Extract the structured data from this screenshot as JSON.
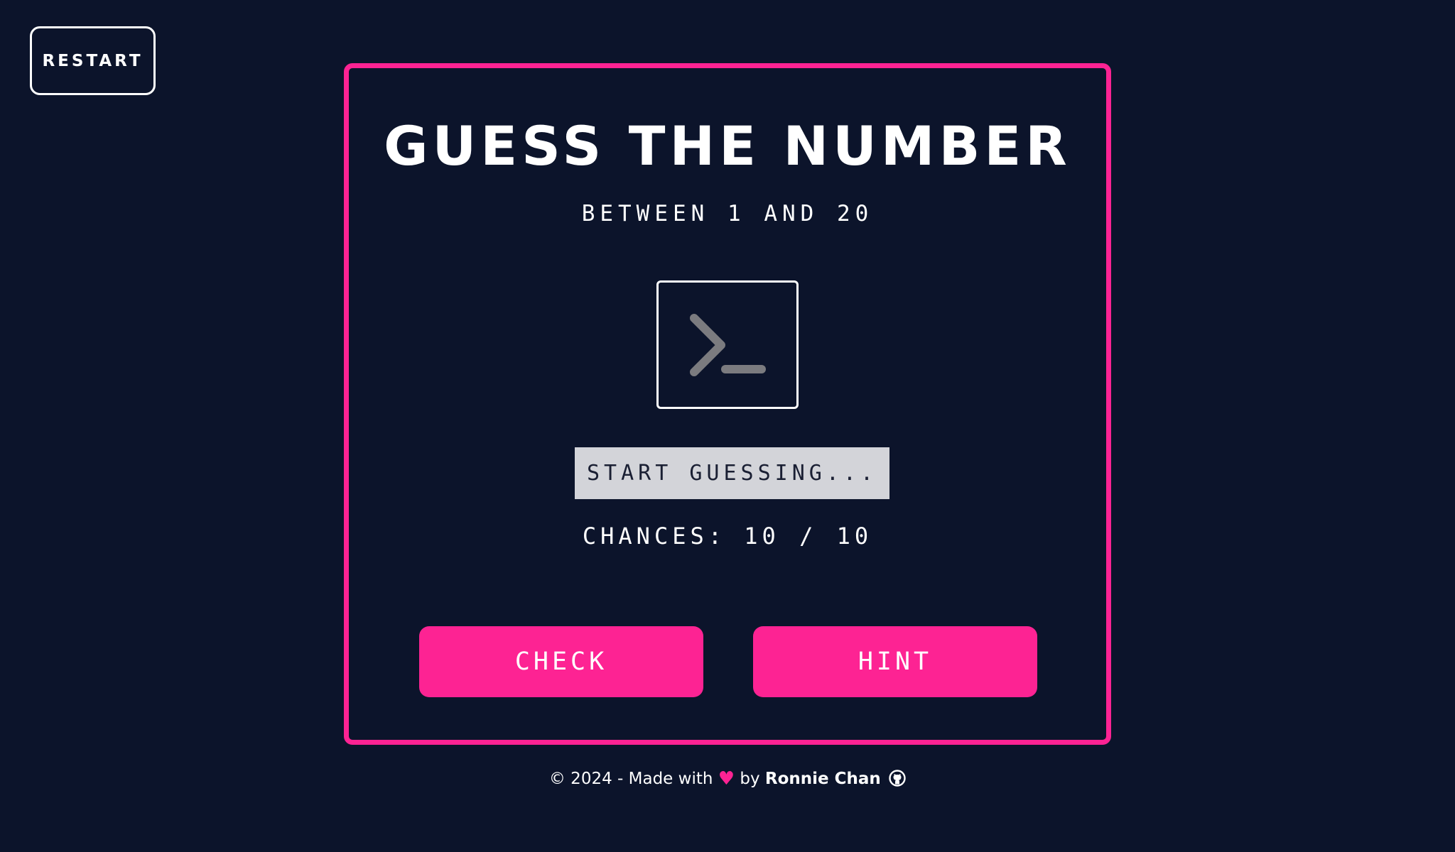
{
  "restart_button": {
    "label": "RESTART"
  },
  "game": {
    "title": "GUESS THE NUMBER",
    "subtitle": "BETWEEN 1 AND 20",
    "terminal_icon": "terminal-prompt-icon",
    "feedback_text": "START GUESSING...",
    "chances": {
      "label": "CHANCES:",
      "remaining": "10",
      "separator": "/",
      "total": "10"
    },
    "check_button": {
      "label": "CHECK"
    },
    "hint_button": {
      "label": "HINT"
    }
  },
  "footer": {
    "copyright": "© 2024 - Made with",
    "heart_icon": "heart-icon",
    "by": "by",
    "author": "Ronnie Chan",
    "github_icon": "github-icon"
  },
  "colors": {
    "background": "#0c142b",
    "accent": "#fd2393",
    "text": "#ffffff",
    "feedback_bg": "#d3d4d9",
    "icon_gray": "#7b7b7f"
  }
}
